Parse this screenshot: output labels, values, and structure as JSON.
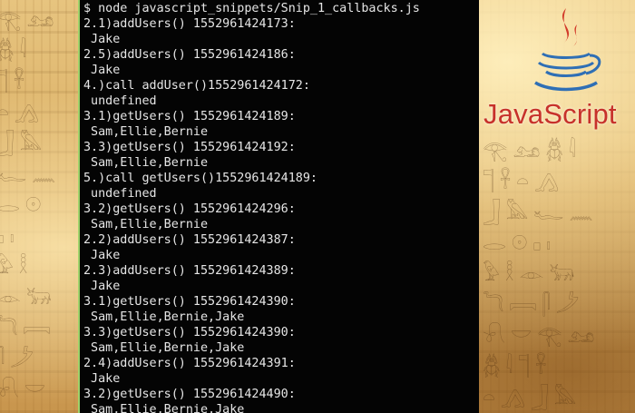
{
  "terminal": {
    "lines": [
      "$ node javascript_snippets/Snip_1_callbacks.js",
      "2.1)addUsers() 1552961424173:",
      " Jake",
      "2.5)addUsers() 1552961424186:",
      " Jake",
      "4.)call addUser()1552961424172:",
      " undefined",
      "3.1)getUsers() 1552961424189:",
      " Sam,Ellie,Bernie",
      "3.3)getUsers() 1552961424192:",
      " Sam,Ellie,Bernie",
      "5.)call getUsers()1552961424189:",
      " undefined",
      "3.2)getUsers() 1552961424296:",
      " Sam,Ellie,Bernie",
      "2.2)addUsers() 1552961424387:",
      " Jake",
      "2.3)addUsers() 1552961424389:",
      " Jake",
      "3.1)getUsers() 1552961424390:",
      " Sam,Ellie,Bernie,Jake",
      "3.3)getUsers() 1552961424390:",
      " Sam,Ellie,Bernie,Jake",
      "2.4)addUsers() 1552961424391:",
      " Jake",
      "3.2)getUsers() 1552961424490:",
      " Sam,Ellie,Bernie,Jake"
    ]
  },
  "logo": {
    "text": "JavaScript",
    "icon": "java-coffee-cup-icon",
    "colors": {
      "flame": "#d23a2a",
      "cup": "#2f6fb5",
      "text": "#c7312a"
    }
  },
  "background": {
    "theme": "papyrus-hieroglyphs",
    "colors": {
      "light": "#e7c47f",
      "dark": "#c8954d",
      "terminal": "#040404",
      "terminal_border": "#9fd26b",
      "terminal_text": "#e6e6e6"
    }
  }
}
